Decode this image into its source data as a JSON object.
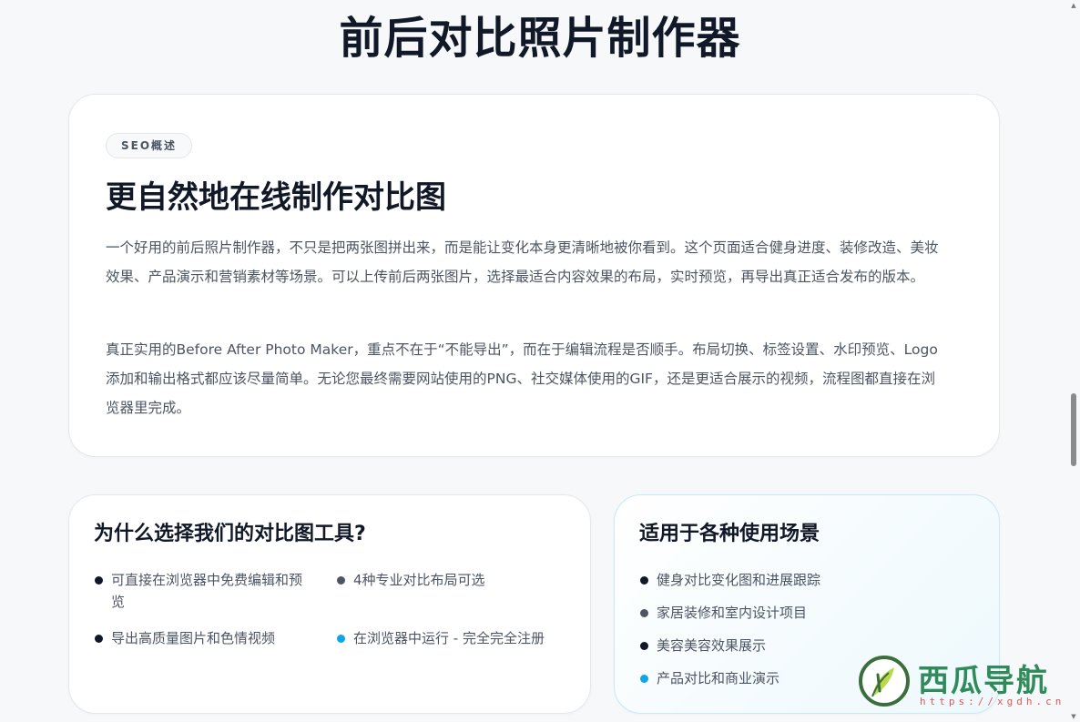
{
  "page": {
    "title": "前后对比照片制作器"
  },
  "seo": {
    "badge": "SEO概述",
    "heading": "更自然地在线制作对比图",
    "paragraph1": "一个好用的前后照片制作器，不只是把两张图拼出来，而是能让变化本身更清晰地被你看到。这个页面适合健身进度、装修改造、美妆效果、产品演示和营销素材等场景。可以上传前后两张图片，选择最适合内容效果的布局，实时预览，再导出真正适合发布的版本。",
    "paragraph2": "真正实用的Before After Photo Maker，重点不在于“不能导出”，而在于编辑流程是否顺手。布局切换、标签设置、水印预览、Logo添加和输出格式都应该尽量简单。无论您最终需要网站使用的PNG、社交媒体使用的GIF，还是更适合展示的视频，流程图都直接在浏览器里完成。"
  },
  "why": {
    "title": "为什么选择我们的对比图工具?",
    "items": [
      {
        "text": "可直接在浏览器中免费编辑和预览",
        "color": "#111827"
      },
      {
        "text": "4种专业对比布局可选",
        "color": "#4b5563"
      },
      {
        "text": "导出高质量图片和色情视频",
        "color": "#111827"
      },
      {
        "text": "在浏览器中运行 - 完全完全注册",
        "color": "#0ea5e9"
      }
    ]
  },
  "usage": {
    "title": "适用于各种使用场景",
    "items": [
      {
        "text": "健身对比变化图和进展跟踪",
        "color": "#111827"
      },
      {
        "text": "家居装修和室内设计项目",
        "color": "#4b5563"
      },
      {
        "text": "美容美容效果展示",
        "color": "#111827"
      },
      {
        "text": "产品对比和商业演示",
        "color": "#0ea5e9"
      }
    ]
  },
  "watermark": {
    "text": "西瓜导航",
    "url": "https://xgdh.cn"
  },
  "icons": {
    "scroll_up": "scroll-up-arrow-icon",
    "scroll_down": "scroll-down-arrow-icon",
    "logo": "watermelon-leaf-logo-icon"
  }
}
